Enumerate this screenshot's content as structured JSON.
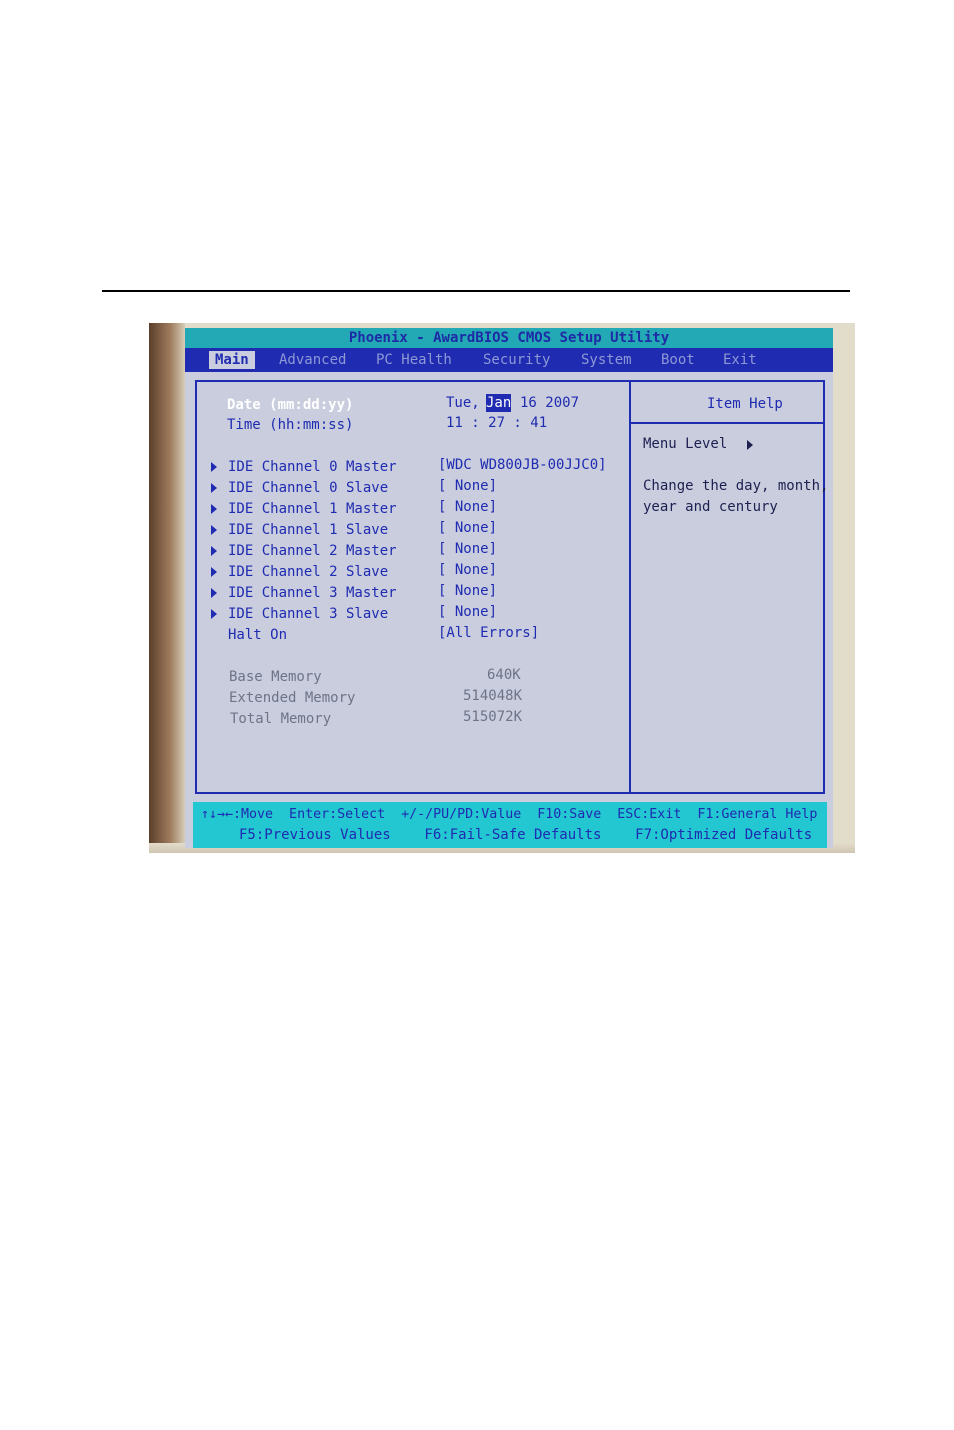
{
  "bios": {
    "title": "Phoenix - AwardBIOS CMOS Setup Utility",
    "menu": [
      "Main",
      "Advanced",
      "PC Health",
      "Security",
      "System",
      "Boot",
      "Exit"
    ],
    "active_menu": "Main",
    "date": {
      "label": "Date (mm:dd:yy)",
      "weekday": "Tue,",
      "month": "Jan",
      "rest": "16 2007"
    },
    "time": {
      "label": "Time (hh:mm:ss)",
      "value": "11 : 27 : 41"
    },
    "ide": [
      {
        "label": "IDE Channel 0 Master",
        "value": "[WDC WD800JB-00JJC0]"
      },
      {
        "label": "IDE Channel 0 Slave",
        "value": "[ None]"
      },
      {
        "label": "IDE Channel 1 Master",
        "value": "[ None]"
      },
      {
        "label": "IDE Channel 1 Slave",
        "value": "[ None]"
      },
      {
        "label": "IDE Channel 2 Master",
        "value": "[ None]"
      },
      {
        "label": "IDE Channel 2 Slave",
        "value": "[ None]"
      },
      {
        "label": "IDE Channel 3 Master",
        "value": "[ None]"
      },
      {
        "label": "IDE Channel 3 Slave",
        "value": "[ None]"
      }
    ],
    "halt_on": {
      "label": "Halt On",
      "value": "[All Errors]"
    },
    "memory": [
      {
        "label": "Base Memory",
        "value": "640K"
      },
      {
        "label": "Extended Memory",
        "value": "514048K"
      },
      {
        "label": "Total Memory",
        "value": "515072K"
      }
    ],
    "help": {
      "title": "Item Help",
      "menu_level": "Menu Level",
      "line1": "Change the day, month,",
      "line2": "year and century"
    },
    "status": {
      "line1": "↑↓→←:Move  Enter:Select  +/-/PU/PD:Value  F10:Save  ESC:Exit  F1:General Help",
      "line2": "F5:Previous Values    F6:Fail-Safe Defaults    F7:Optimized Defaults"
    }
  }
}
